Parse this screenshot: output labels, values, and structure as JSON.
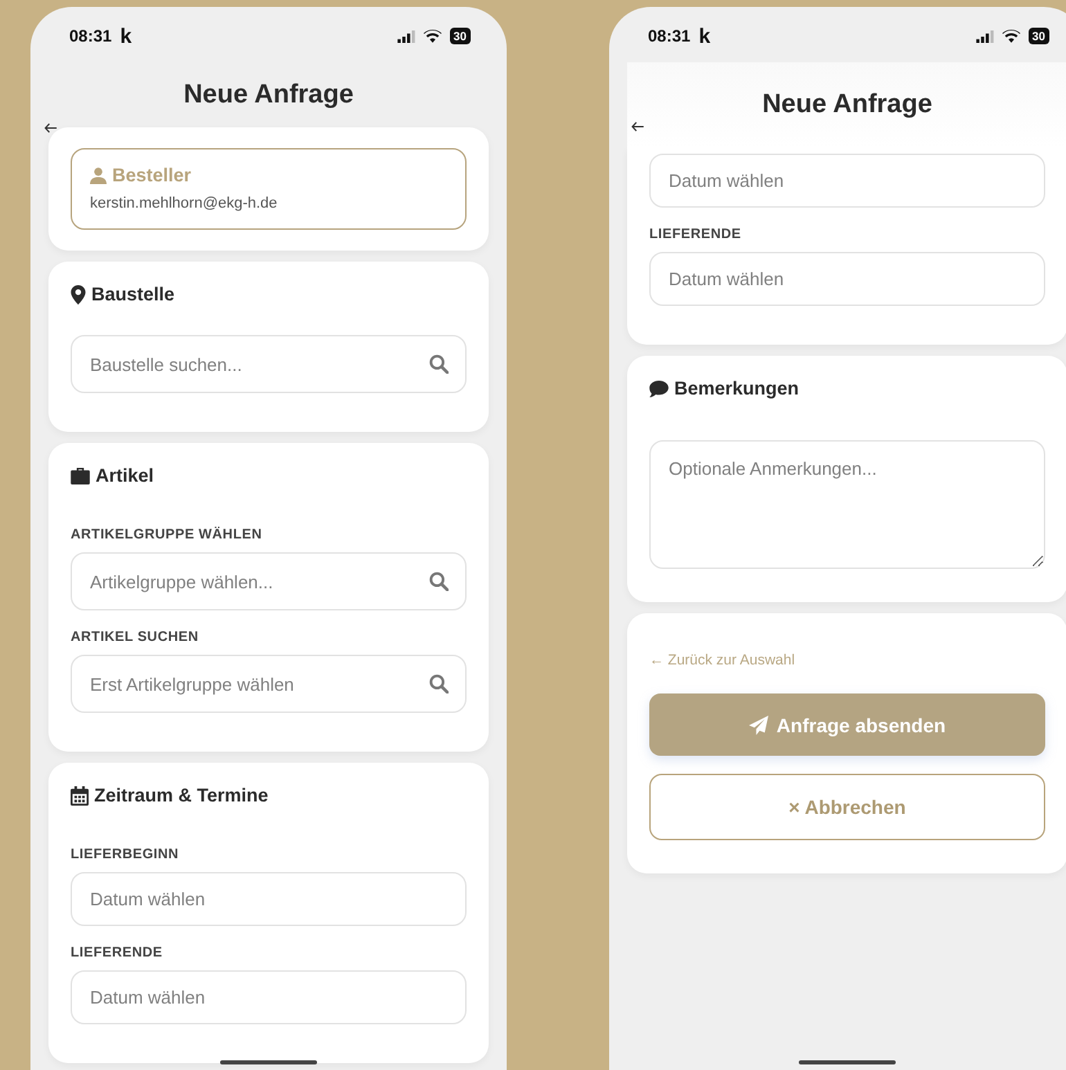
{
  "screens": [
    {
      "status_bar": {
        "time": "08:31",
        "carrier": "k",
        "battery": "30"
      },
      "title": "Neue Anfrage",
      "sections": [
        {
          "kind": "orderer",
          "label": "Besteller",
          "value": "kerstin.mehlhorn@ekg-h.de"
        },
        {
          "kind": "site",
          "heading": "Baustelle",
          "fields": [
            {
              "kind": "search",
              "placeholder": "Baustelle suchen..."
            }
          ]
        },
        {
          "kind": "articles",
          "heading": "Artikel",
          "fields": [
            {
              "kind": "search",
              "label": "ARTIKELGRUPPE WÄHLEN",
              "placeholder": "Artikelgruppe wählen..."
            },
            {
              "kind": "search",
              "label": "ARTIKEL SUCHEN",
              "placeholder": "Erst Artikelgruppe wählen"
            }
          ]
        },
        {
          "kind": "schedule",
          "heading": "Zeitraum & Termine",
          "fields": [
            {
              "kind": "date",
              "label": "LIEFERBEGINN",
              "placeholder": "Datum wählen"
            },
            {
              "kind": "date",
              "label": "LIEFERENDE",
              "placeholder": "Datum wählen"
            }
          ]
        }
      ]
    },
    {
      "status_bar": {
        "time": "08:31",
        "carrier": "k",
        "battery": "30"
      },
      "title": "Neue Anfrage",
      "sections": [
        {
          "kind": "schedule",
          "fields": [
            {
              "kind": "date",
              "placeholder": "Datum wählen"
            },
            {
              "kind": "date",
              "label": "LIEFERENDE",
              "placeholder": "Datum wählen"
            }
          ]
        },
        {
          "kind": "remarks",
          "heading": "Bemerkungen",
          "fields": [
            {
              "kind": "multiline",
              "placeholder": "Optionale Anmerkungen..."
            }
          ]
        },
        {
          "kind": "actions",
          "link": "← Zurück zur Auswahl",
          "primary": "Anfrage absenden",
          "secondary": "× Abbrechen"
        }
      ]
    }
  ]
}
